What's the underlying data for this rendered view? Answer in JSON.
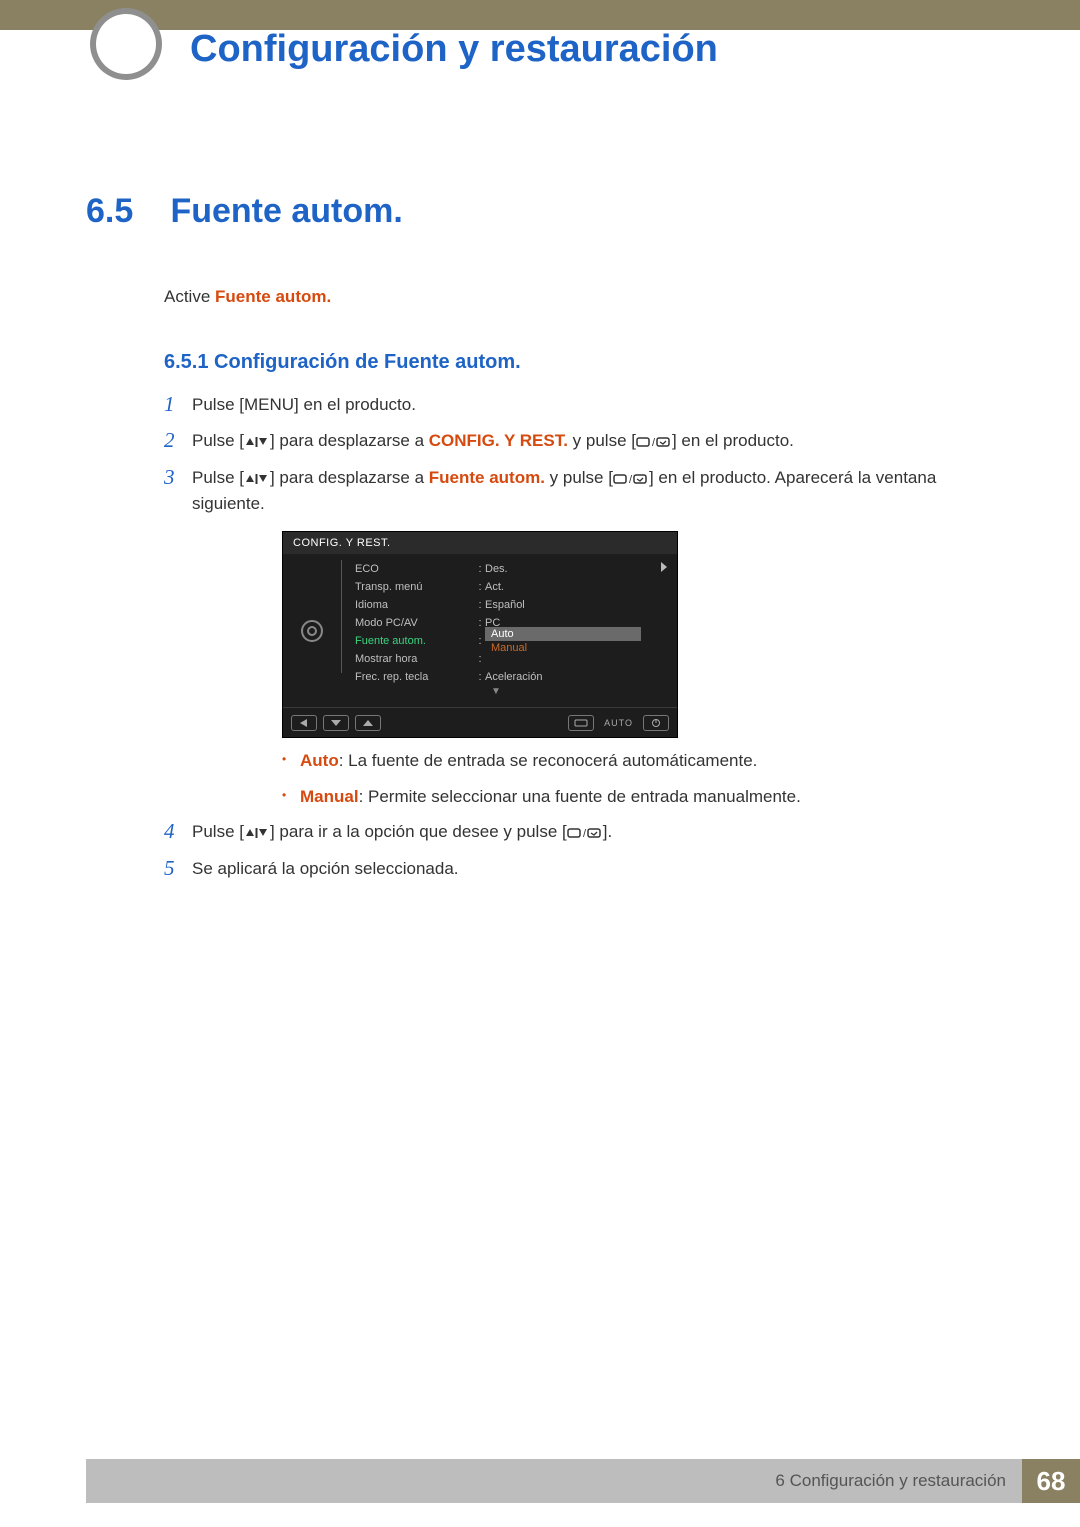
{
  "chapter_title": "Configuración y restauración",
  "section": {
    "num": "6.5",
    "title": "Fuente autom."
  },
  "intro": {
    "pre": "Active ",
    "hl": "Fuente autom."
  },
  "subsection": "6.5.1  Configuración de Fuente autom.",
  "steps": {
    "s1": {
      "num": "1",
      "a": "Pulse [",
      "key": "MENU",
      "b": "] en el producto."
    },
    "s2": {
      "num": "2",
      "a": "Pulse [",
      "b": "] para desplazarse a ",
      "hl": "CONFIG. Y REST.",
      "c": " y pulse [",
      "d": "] en el producto."
    },
    "s3": {
      "num": "3",
      "a": "Pulse [",
      "b": "] para desplazarse a ",
      "hl": "Fuente autom.",
      "c": " y pulse [",
      "d": "] en el producto. Aparecerá la ventana siguiente."
    },
    "s4": {
      "num": "4",
      "a": "Pulse [",
      "b": "] para ir a la opción que desee y pulse [",
      "c": "]."
    },
    "s5": {
      "num": "5",
      "a": "Se aplicará la opción seleccionada."
    }
  },
  "osd": {
    "title": "CONFIG. Y REST.",
    "rows": [
      {
        "label": "ECO",
        "value": "Des."
      },
      {
        "label": "Transp. menú",
        "value": "Act."
      },
      {
        "label": "Idioma",
        "value": "Español"
      },
      {
        "label": "Modo PC/AV",
        "value": "PC"
      },
      {
        "label": "Fuente autom.",
        "value": "Auto"
      },
      {
        "label": "Mostrar hora",
        "value": ""
      },
      {
        "label": "Frec. rep. tecla",
        "value": "Aceleración"
      }
    ],
    "options": {
      "sel": "Auto",
      "unsel": "Manual"
    },
    "foot_auto": "AUTO"
  },
  "bullets": {
    "b1": {
      "hl": "Auto",
      "text": ": La fuente de entrada se reconocerá automáticamente."
    },
    "b2": {
      "hl": "Manual",
      "text": ": Permite seleccionar una fuente de entrada manualmente."
    }
  },
  "footer": {
    "text": "6 Configuración y restauración",
    "page": "68"
  }
}
